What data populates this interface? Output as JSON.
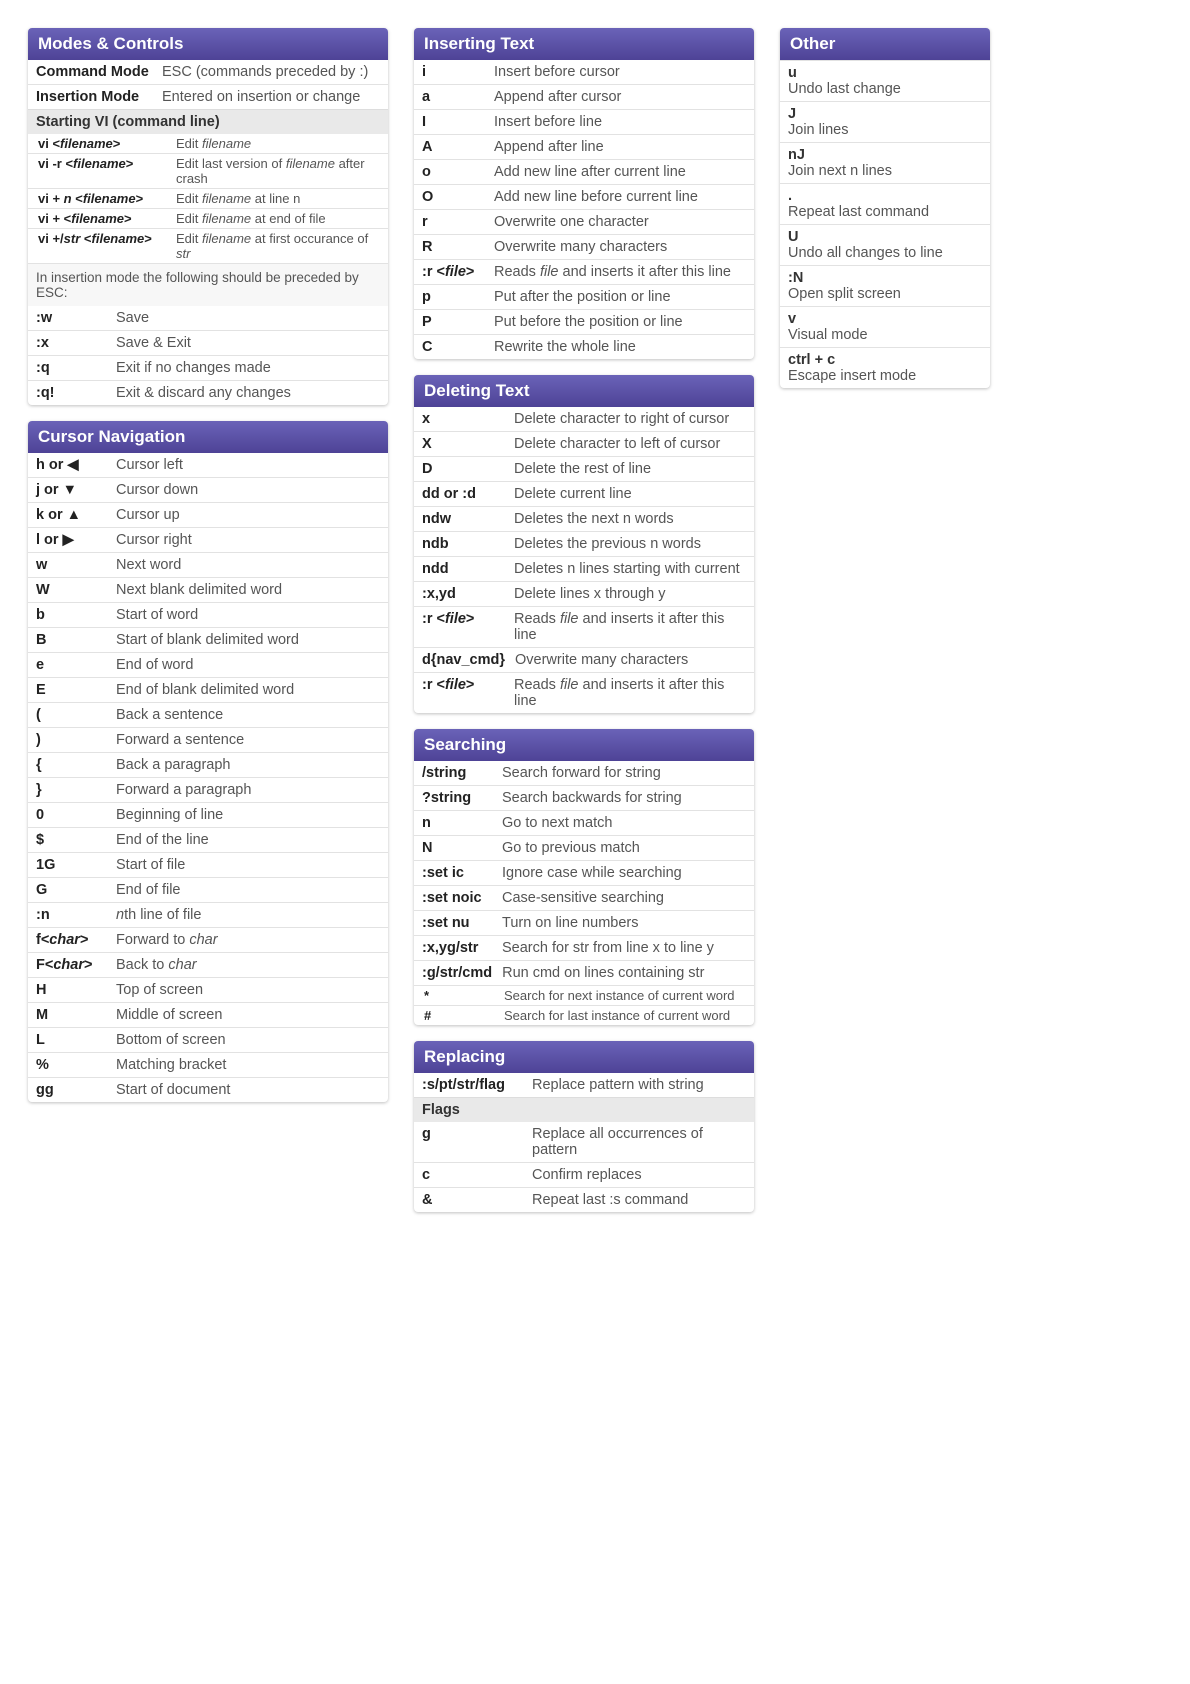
{
  "col1": {
    "modes": {
      "title": "Modes & Controls",
      "rows": [
        {
          "k": "Command Mode",
          "d": "ESC (commands preceded by :)"
        },
        {
          "k": "Insertion Mode",
          "d": "Entered on insertion or change"
        }
      ],
      "starting_title": "Starting VI (command line)",
      "starting": [
        {
          "k": "vi <filename>",
          "d": "Edit filename",
          "em_k": true,
          "em_d": "filename"
        },
        {
          "k": "vi -r <filename>",
          "d": "Edit last version of filename after crash",
          "em_k": true,
          "em_d": "filename"
        },
        {
          "k": "vi + n <filename>",
          "d": "Edit filename at line n",
          "em_k": true,
          "em_d": "filename|n"
        },
        {
          "k": "vi + <filename>",
          "d": "Edit filename at end of file",
          "em_k": true,
          "em_d": "filename"
        },
        {
          "k": "vi +/str <filename>",
          "d": "Edit filename at first occurance of str",
          "em_k": true,
          "em_d": "filename|str"
        }
      ],
      "note": "In insertion mode the following should be preceded by ESC:",
      "esc_rows": [
        {
          "k": ":w",
          "d": "Save"
        },
        {
          "k": ":x",
          "d": "Save & Exit"
        },
        {
          "k": ":q",
          "d": "Exit if no changes made"
        },
        {
          "k": ":q!",
          "d": "Exit & discard any changes"
        }
      ]
    },
    "cursor": {
      "title": "Cursor Navigation",
      "rows": [
        {
          "k": "h or ◀",
          "d": "Cursor left"
        },
        {
          "k": "j or ▼",
          "d": "Cursor down"
        },
        {
          "k": "k or ▲",
          "d": "Cursor up"
        },
        {
          "k": "l or ▶",
          "d": "Cursor right"
        },
        {
          "k": "w",
          "d": "Next word"
        },
        {
          "k": "W",
          "d": "Next blank delimited word"
        },
        {
          "k": "b",
          "d": "Start of word"
        },
        {
          "k": "B",
          "d": "Start of blank delimited word"
        },
        {
          "k": "e",
          "d": "End of word"
        },
        {
          "k": "E",
          "d": "End of blank delimited word"
        },
        {
          "k": "(",
          "d": "Back a sentence"
        },
        {
          "k": ")",
          "d": "Forward a sentence"
        },
        {
          "k": "{",
          "d": "Back a paragraph"
        },
        {
          "k": "}",
          "d": "Forward a paragraph"
        },
        {
          "k": "0",
          "d": "Beginning of line"
        },
        {
          "k": "$",
          "d": "End of the line"
        },
        {
          "k": "1G",
          "d": "Start of file"
        },
        {
          "k": "G",
          "d": "End of file"
        },
        {
          "k": ":n",
          "d": "nth line of file",
          "em_d": "n"
        },
        {
          "k": "f<char>",
          "d": "Forward to char",
          "em_k": true,
          "em_d": "char"
        },
        {
          "k": "F<char>",
          "d": "Back to char",
          "em_k": true,
          "em_d": "char"
        },
        {
          "k": "H",
          "d": "Top of screen"
        },
        {
          "k": "M",
          "d": "Middle of screen"
        },
        {
          "k": "L",
          "d": "Bottom of screen"
        },
        {
          "k": "%",
          "d": "Matching bracket"
        },
        {
          "k": "gg",
          "d": "Start of document"
        }
      ]
    }
  },
  "col2": {
    "inserting": {
      "title": "Inserting Text",
      "rows": [
        {
          "k": "i",
          "d": "Insert before cursor"
        },
        {
          "k": "a",
          "d": "Append after cursor"
        },
        {
          "k": "I",
          "d": "Insert before line"
        },
        {
          "k": "A",
          "d": "Append after line"
        },
        {
          "k": "o",
          "d": "Add new line after current line"
        },
        {
          "k": "O",
          "d": "Add new line before current line"
        },
        {
          "k": "r",
          "d": "Overwrite one character"
        },
        {
          "k": "R",
          "d": "Overwrite many characters"
        },
        {
          "k": ":r <file>",
          "d": "Reads file and inserts it after this line",
          "em_k": true,
          "em_d": "file"
        },
        {
          "k": "p",
          "d": "Put after the position or line"
        },
        {
          "k": "P",
          "d": "Put before the position or line"
        },
        {
          "k": "C",
          "d": "Rewrite the whole line"
        }
      ]
    },
    "deleting": {
      "title": "Deleting Text",
      "rows": [
        {
          "k": "x",
          "d": "Delete character to right of cursor"
        },
        {
          "k": "X",
          "d": "Delete character to left of cursor"
        },
        {
          "k": "D",
          "d": "Delete the rest of line"
        },
        {
          "k": "dd or :d",
          "d": "Delete current line"
        },
        {
          "k": "ndw",
          "d": "Deletes the next n words"
        },
        {
          "k": "ndb",
          "d": "Deletes the previous n words"
        },
        {
          "k": "ndd",
          "d": "Deletes n lines starting with current"
        },
        {
          "k": ":x,yd",
          "d": "Delete lines x through y"
        },
        {
          "k": ":r <file>",
          "d": "Reads file and inserts it after this line",
          "em_k": true,
          "em_d": "file"
        },
        {
          "k": "d{nav_cmd}",
          "d": "Overwrite many characters"
        },
        {
          "k": ":r <file>",
          "d": "Reads file and inserts it after this line",
          "em_k": true,
          "em_d": "file"
        }
      ]
    },
    "searching": {
      "title": "Searching",
      "rows": [
        {
          "k": "/string",
          "d": "Search forward for string"
        },
        {
          "k": "?string",
          "d": "Search backwards for string"
        },
        {
          "k": "n",
          "d": "Go to next match"
        },
        {
          "k": "N",
          "d": "Go to previous match"
        },
        {
          "k": ":set ic",
          "d": "Ignore case while searching"
        },
        {
          "k": ":set noic",
          "d": "Case-sensitive searching"
        },
        {
          "k": ":set nu",
          "d": "Turn on line numbers"
        },
        {
          "k": ":x,yg/str",
          "d": "Search for str from line x to line y"
        },
        {
          "k": ":g/str/cmd",
          "d": "Run cmd on lines containing str"
        },
        {
          "k": "*",
          "d": "Search for next instance of current word",
          "sm": true
        },
        {
          "k": "#",
          "d": "Search for last instance of current word",
          "sm": true
        }
      ]
    },
    "replacing": {
      "title": "Replacing",
      "rows": [
        {
          "k": ":s/pt/str/flag",
          "d": "Replace pattern with string"
        }
      ],
      "flags_title": "Flags",
      "flags": [
        {
          "k": "g",
          "d": "Replace all occurrences of pattern"
        },
        {
          "k": "c",
          "d": "Confirm replaces"
        },
        {
          "k": "&",
          "d": "Repeat last :s command"
        }
      ]
    }
  },
  "col3": {
    "other": {
      "title": "Other",
      "rows": [
        {
          "k": "u",
          "d": "Undo last change"
        },
        {
          "k": "J",
          "d": "Join lines"
        },
        {
          "k": "nJ",
          "d": "Join next n lines"
        },
        {
          "k": ".",
          "d": "Repeat last command"
        },
        {
          "k": "U",
          "d": "Undo all changes to line"
        },
        {
          "k": ":N",
          "d": "Open split screen"
        },
        {
          "k": "v",
          "d": "Visual mode"
        },
        {
          "k": "ctrl + c",
          "d": "Escape insert mode"
        }
      ]
    }
  }
}
